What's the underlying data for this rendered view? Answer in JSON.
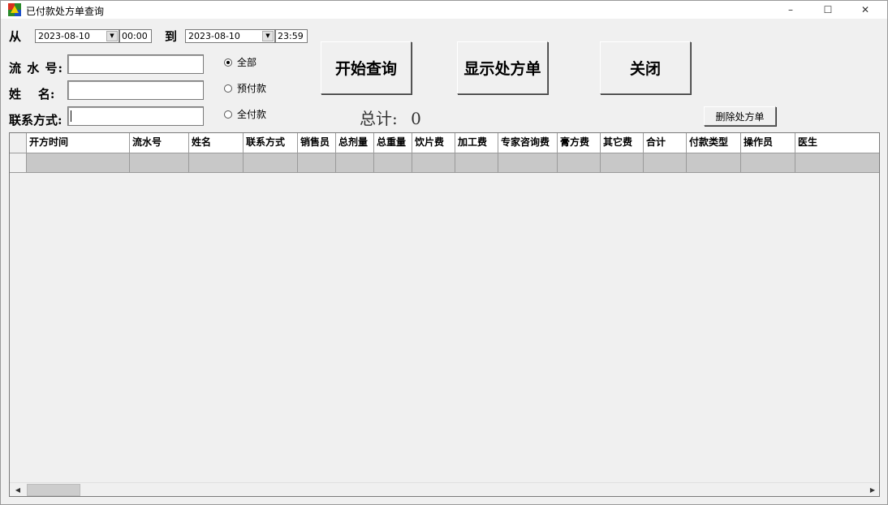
{
  "window": {
    "title": "已付款处方单查询",
    "controls": {
      "minimize": "–",
      "maximize": "☐",
      "close": "✕"
    }
  },
  "date_range": {
    "from_label": "从",
    "to_label": "到",
    "from_date": "2023-08-10",
    "from_time": "00:00",
    "to_date": "2023-08-10",
    "to_time": "23:59"
  },
  "fields": {
    "serial_label": "流 水 号:",
    "serial_value": "",
    "name_label": "姓    名:",
    "name_value": "",
    "contact_label": "联系方式:",
    "contact_value": ""
  },
  "payment_filter": {
    "selected": "all",
    "options": [
      {
        "key": "all",
        "label": "全部"
      },
      {
        "key": "prepaid",
        "label": "预付款"
      },
      {
        "key": "full",
        "label": "全付款"
      }
    ]
  },
  "buttons": {
    "query": "开始查询",
    "show_prescription": "显示处方单",
    "close": "关闭",
    "delete_prescription": "删除处方单"
  },
  "total": {
    "label": "总计:",
    "value": "0"
  },
  "table": {
    "columns": [
      "开方时间",
      "流水号",
      "姓名",
      "联系方式",
      "销售员",
      "总剂量",
      "总重量",
      "饮片费",
      "加工费",
      "专家咨询费",
      "膏方费",
      "其它费",
      "合计",
      "付款类型",
      "操作员",
      "医生"
    ],
    "rows": []
  },
  "colors": {
    "selected_row": "#c8c8c8",
    "window_bg": "#f0f0f0"
  }
}
